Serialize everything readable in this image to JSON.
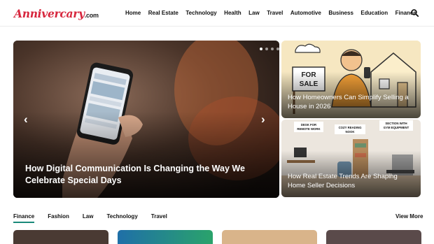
{
  "header": {
    "logo_main": "Annivercary",
    "logo_tld": ".com",
    "nav": [
      "Home",
      "Real Estate",
      "Technology",
      "Health",
      "Law",
      "Travel",
      "Automotive",
      "Business",
      "Education",
      "Finance"
    ],
    "search_icon": "search-icon"
  },
  "slider": {
    "title": "How Digital Communication Is Changing the Way We Celebrate Special Days",
    "dots_total": 5,
    "dot_active": 1,
    "prev_icon": "chevron-left-icon",
    "next_icon": "chevron-right-icon"
  },
  "cards": [
    {
      "title": "How Homeowners Can Simplify Selling a House in 2026",
      "sign_text": "FOR SALE"
    },
    {
      "title": "How Real Estate Trends Are Shaping Home Seller Decisions",
      "labels": [
        "DESK FOR REMOTE WORK",
        "COZY READING NOOK",
        "SECTION WITH GYM EQUIPMENT"
      ]
    }
  ],
  "tabs": {
    "items": [
      "Finance",
      "Fashion",
      "Law",
      "Technology",
      "Travel"
    ],
    "active": "Finance",
    "view_more": "View More"
  },
  "colors": {
    "brand": "#d7263d",
    "tab_underline": "#1a8a7a"
  }
}
